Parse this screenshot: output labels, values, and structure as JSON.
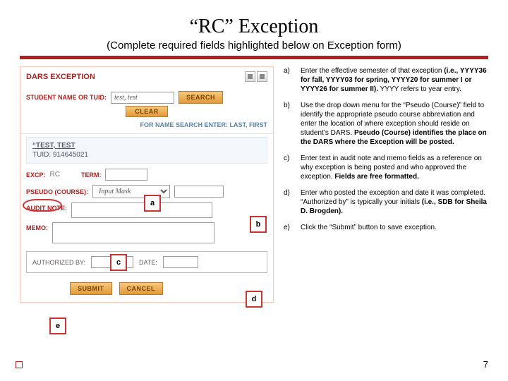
{
  "title": "“RC” Exception",
  "subtitle_pre": "(",
  "subtitle_mid": "Complete required fields highlighted below on Exception form)",
  "form": {
    "header": "DARS EXCEPTION",
    "student_label": "STUDENT NAME OR TUID:",
    "student_value": "test, test",
    "search_btn": "SEARCH",
    "clear_btn": "CLEAR",
    "name_hint": "FOR NAME SEARCH ENTER: LAST, FIRST",
    "student_name": "“TEST, TEST",
    "tuid_label": "TUID:",
    "tuid_value": "914645021",
    "excp_label": "EXCP:",
    "excp_value": "RC",
    "term_label": "TERM:",
    "term_value": "",
    "pseudo_label": "PSEUDO (COURSE):",
    "pseudo_value": "Input Mask",
    "audit_label": "AUDIT NOTE:",
    "memo_label": "MEMO:",
    "auth_label": "AUTHORIZED BY:",
    "auth_value": "",
    "date_label": "DATE:",
    "date_value": "",
    "submit_btn": "SUBMIT",
    "cancel_btn": "CANCEL"
  },
  "callouts": {
    "a": "a",
    "b": "b",
    "c": "c",
    "d": "d",
    "e": "e"
  },
  "instructions": [
    {
      "letter": "a)",
      "html": "Enter the effective semester of that exception <b>(i.e., YYYY36 for fall, YYYY03 for spring, YYYY20 for summer I or YYYY26 for summer II).</b> YYYY refers to year entry."
    },
    {
      "letter": "b)",
      "html": "Use the drop down menu for the “Pseudo (Course)” field to identify the appropriate pseudo course abbreviation and enter the location of where exception should reside on student’s DARS. <b>Pseudo (Course) identifies the place on the DARS where the Exception will be posted.</b>"
    },
    {
      "letter": "c)",
      "html": "Enter text in audit note and memo fields as a reference on why exception is being posted and who approved the exception. <b>Fields are free formatted.</b>"
    },
    {
      "letter": "d)",
      "html": "Enter who posted the exception and date it was completed. “Authorized by” is typically your initials <b>(i.e., SDB for Sheila D. Brogden).</b>"
    },
    {
      "letter": "e)",
      "html": "Click the “Submit” button to save exception."
    }
  ],
  "page_number": "7"
}
